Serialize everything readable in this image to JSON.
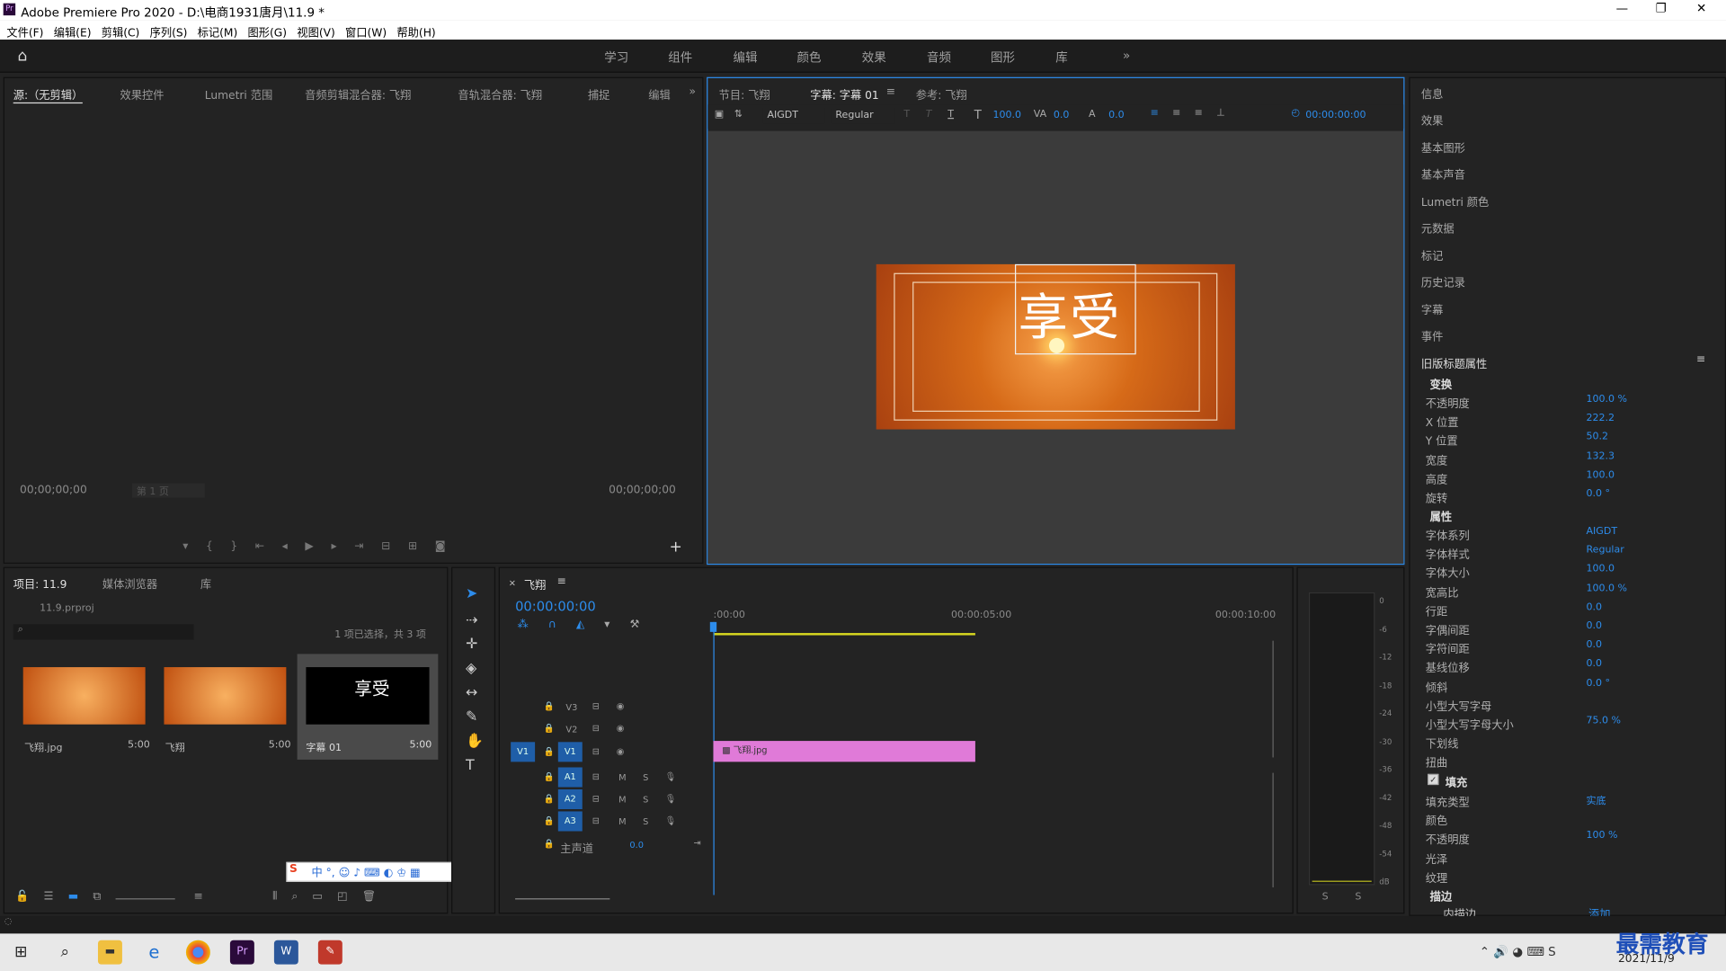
{
  "window": {
    "title": "Adobe Premiere Pro 2020 - D:\\电商1931唐月\\11.9 *",
    "controls": [
      "—",
      "❐",
      "✕"
    ]
  },
  "menu": [
    "文件(F)",
    "编辑(E)",
    "剪辑(C)",
    "序列(S)",
    "标记(M)",
    "图形(G)",
    "视图(V)",
    "窗口(W)",
    "帮助(H)"
  ],
  "workspaces": [
    "学习",
    "组件",
    "编辑",
    "颜色",
    "效果",
    "音频",
    "图形",
    "库"
  ],
  "source_panel": {
    "tabs": [
      "源:（无剪辑）",
      "效果控件",
      "Lumetri 范围",
      "音频剪辑混合器: 飞翔",
      "音轨混合器: 飞翔",
      "捕捉",
      "编辑"
    ],
    "tc_left": "00;00;00;00",
    "tc_right": "00;00;00;00",
    "page": "第 1 页"
  },
  "program_panel": {
    "tabs": [
      "节目: 飞翔",
      "字幕: 字幕 01",
      "参考: 飞翔"
    ],
    "font": "AIGDT",
    "style": "Regular",
    "size": "100.0",
    "kerning": "0.0",
    "leading": "0.0",
    "timecode": "00:00:00:00",
    "title_text": "享受"
  },
  "right_panel": {
    "items": [
      "信息",
      "效果",
      "基本图形",
      "基本声音",
      "Lumetri 颜色",
      "元数据",
      "标记",
      "历史记录",
      "字幕",
      "事件"
    ],
    "legacy_title": "旧版标题属性",
    "transform_header": "变换",
    "transform": [
      {
        "label": "不透明度",
        "value": "100.0 %"
      },
      {
        "label": "X 位置",
        "value": "222.2"
      },
      {
        "label": "Y 位置",
        "value": "50.2"
      },
      {
        "label": "宽度",
        "value": "132.3"
      },
      {
        "label": "高度",
        "value": "100.0"
      },
      {
        "label": "旋转",
        "value": "0.0 °"
      }
    ],
    "props_header": "属性",
    "props": [
      {
        "label": "字体系列",
        "value": "AIGDT"
      },
      {
        "label": "字体样式",
        "value": "Regular"
      },
      {
        "label": "字体大小",
        "value": "100.0"
      },
      {
        "label": "宽高比",
        "value": "100.0 %"
      },
      {
        "label": "行距",
        "value": "0.0"
      },
      {
        "label": "字偶间距",
        "value": "0.0"
      },
      {
        "label": "字符间距",
        "value": "0.0"
      },
      {
        "label": "基线位移",
        "value": "0.0"
      },
      {
        "label": "倾斜",
        "value": "0.0 °"
      },
      {
        "label": "小型大写字母",
        "value": ""
      },
      {
        "label": "小型大写字母大小",
        "value": "75.0 %"
      },
      {
        "label": "下划线",
        "value": ""
      },
      {
        "label": "扭曲",
        "value": ""
      }
    ],
    "fill_header": "填充",
    "fill": [
      {
        "label": "填充类型",
        "value": "实底"
      },
      {
        "label": "颜色",
        "value": ""
      },
      {
        "label": "不透明度",
        "value": "100 %"
      },
      {
        "label": "光泽",
        "value": ""
      },
      {
        "label": "纹理",
        "value": ""
      }
    ],
    "stroke_header": "描边",
    "inner_stroke": "内描边",
    "add": "添加"
  },
  "project_panel": {
    "tabs": [
      "项目: 11.9",
      "媒体浏览器",
      "库"
    ],
    "file": "11.9.prproj",
    "status": "1 项已选择，共 3 项",
    "items": [
      {
        "name": "飞翔.jpg",
        "dur": "5:00"
      },
      {
        "name": "飞翔",
        "dur": "5:00"
      },
      {
        "name": "字幕 01",
        "dur": "5:00",
        "thumb_text": "享受"
      }
    ]
  },
  "timeline": {
    "tab": "飞翔",
    "timecode": "00:00:00:00",
    "ruler": [
      ":00:00",
      "00:00:05:00",
      "00:00:10:00"
    ],
    "video_tracks": [
      "V3",
      "V2",
      "V1"
    ],
    "audio_tracks": [
      "A1",
      "A2",
      "A3"
    ],
    "master": "主声道",
    "master_val": "0.0",
    "clip": "飞翔.jpg",
    "src_v": "V1"
  },
  "meter": {
    "scale": [
      "0",
      "-6",
      "-12",
      "-18",
      "-24",
      "-30",
      "-36",
      "-42",
      "-48",
      "-54",
      "dB"
    ],
    "solo": [
      "S",
      "S"
    ]
  },
  "taskbar": {
    "date": "2021/11/9",
    "watermark": "最需教育"
  },
  "colors": {
    "accent": "#2d8ceb",
    "clip": "#e07ad8",
    "title_bg": "#d2691e"
  }
}
